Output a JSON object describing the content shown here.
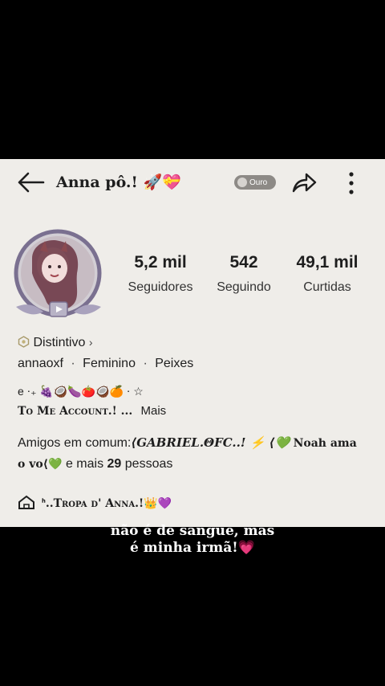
{
  "header": {
    "username": "Anna pô.! 🚀💝",
    "badge_label": "Ouro"
  },
  "stats": [
    {
      "value": "5,2 mil",
      "label": "Seguidores"
    },
    {
      "value": "542",
      "label": "Seguindo"
    },
    {
      "value": "49,1 mil",
      "label": "Curtidas"
    }
  ],
  "profile": {
    "distintivo": "Distintivo",
    "distintivo_chevron": "›",
    "handle": "annaoxf",
    "gender": "Feminino",
    "sign": "Peixes",
    "sep": "·",
    "bio_line1": "e ⋅₊ 🍇🥥🍆🍅🥥🍊 ⋅ ☆",
    "bio_line2": "To Me Account.! ...",
    "bio_more": "Mais",
    "mutual_prefix": "Amigos em comum:",
    "mutual_name1": "⟨GABRIEL.ΘFC..! ⚡ ⟨💚",
    "mutual_name2": "Noah ama",
    "mutual_name3": "o vo⟨💚",
    "mutual_mid": " e mais ",
    "mutual_count": "29",
    "mutual_suffix": " pessoas",
    "group_name": "ᑋ..Tropa d' Anna.!👑💜"
  },
  "caption": {
    "line1": "não é de sangue, mas",
    "line2": "é minha irmã!💗"
  },
  "colors": {
    "background": "#000000",
    "panel": "#efede9",
    "text": "#1e1e1e",
    "badge": "#8d8a86"
  }
}
